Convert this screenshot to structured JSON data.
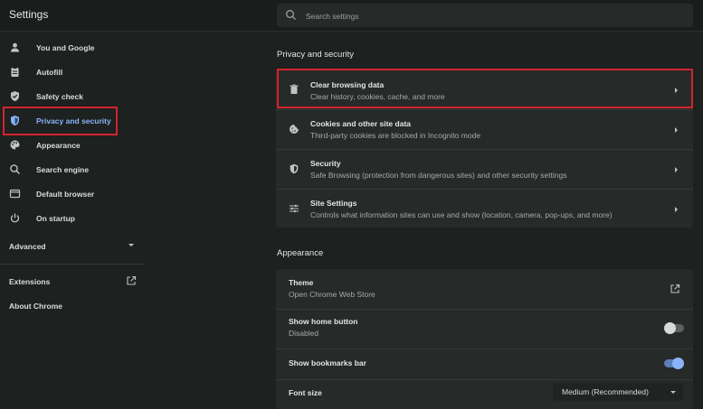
{
  "header": {
    "title": "Settings",
    "search_placeholder": "Search settings"
  },
  "sidebar": {
    "items": [
      {
        "label": "You and Google",
        "icon": "person-icon"
      },
      {
        "label": "Autofill",
        "icon": "clipboard-icon"
      },
      {
        "label": "Safety check",
        "icon": "shield-check-icon"
      },
      {
        "label": "Privacy and security",
        "icon": "shield-icon",
        "active": true
      },
      {
        "label": "Appearance",
        "icon": "palette-icon"
      },
      {
        "label": "Search engine",
        "icon": "search-icon"
      },
      {
        "label": "Default browser",
        "icon": "browser-window-icon"
      },
      {
        "label": "On startup",
        "icon": "power-icon"
      }
    ],
    "advanced": "Advanced",
    "extensions": "Extensions",
    "about": "About Chrome"
  },
  "privacy": {
    "section_title": "Privacy and security",
    "rows": [
      {
        "title": "Clear browsing data",
        "subtitle": "Clear history, cookies, cache, and more",
        "icon": "trash-icon"
      },
      {
        "title": "Cookies and other site data",
        "subtitle": "Third-party cookies are blocked in Incognito mode",
        "icon": "cookie-icon"
      },
      {
        "title": "Security",
        "subtitle": "Safe Browsing (protection from dangerous sites) and other security settings",
        "icon": "shield-icon"
      },
      {
        "title": "Site Settings",
        "subtitle": "Controls what information sites can use and show (location, camera, pop-ups, and more)",
        "icon": "sliders-icon"
      }
    ]
  },
  "appearance": {
    "section_title": "Appearance",
    "theme": {
      "title": "Theme",
      "subtitle": "Open Chrome Web Store"
    },
    "home_button": {
      "title": "Show home button",
      "subtitle": "Disabled",
      "enabled": false
    },
    "bookmarks_bar": {
      "title": "Show bookmarks bar",
      "enabled": true
    },
    "font_size": {
      "title": "Font size",
      "value": "Medium (Recommended)"
    }
  },
  "colors": {
    "background": "#1d211f",
    "card": "#262a28",
    "accent": "#8ab4f8",
    "highlight_box": "#d3232e"
  }
}
